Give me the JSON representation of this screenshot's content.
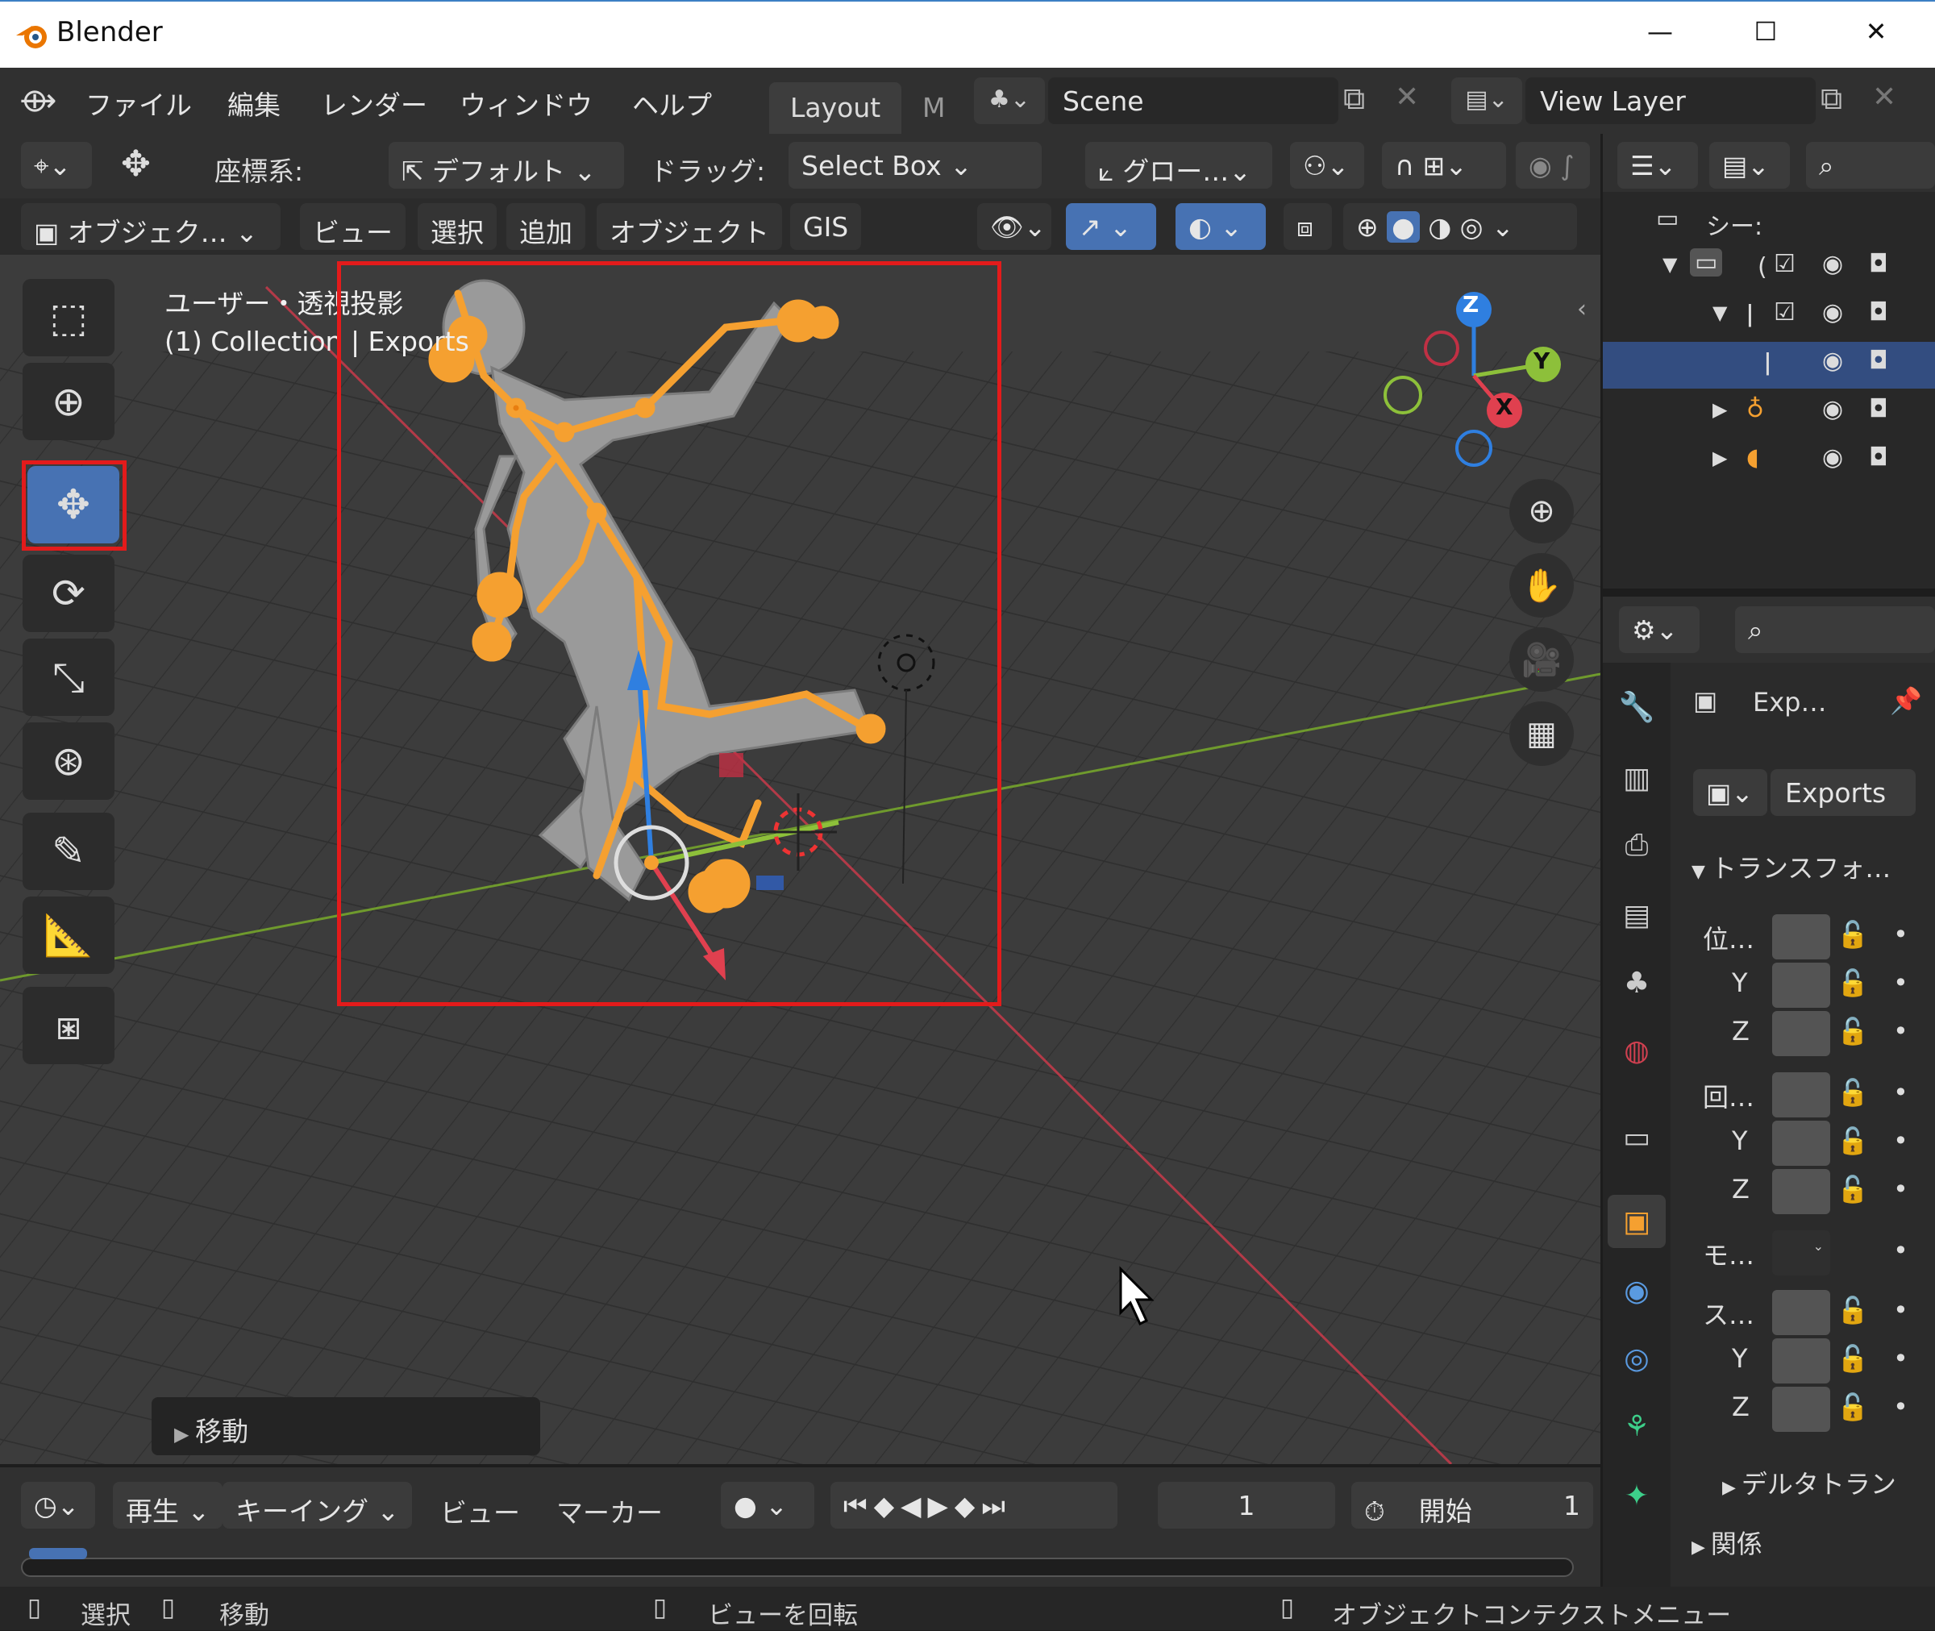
{
  "window": {
    "app_title": "Blender",
    "minimize": "—",
    "maximize": "☐",
    "close": "✕"
  },
  "menubar": {
    "items": [
      "ファイル",
      "編集",
      "レンダー",
      "ウィンドウ",
      "ヘルプ"
    ],
    "workspace_tabs": [
      "Layout",
      "M"
    ],
    "scene": "Scene",
    "view_layer": "View Layer"
  },
  "tool_header": {
    "orientation_label": "座標系:",
    "orientation_value": "デフォルト",
    "drag_label": "ドラッグ:",
    "drag_value": "Select Box",
    "pivot": "グロー…"
  },
  "view_header": {
    "mode": "オブジェク…",
    "menus": [
      "ビュー",
      "選択",
      "追加",
      "オブジェクト",
      "GIS"
    ]
  },
  "viewport": {
    "view_name": "ユーザー・透視投影",
    "collection_info": "(1) Collection | Exports",
    "last_operator": "移動",
    "gizmo_axes": {
      "z": "Z",
      "y": "Y",
      "x": "X"
    }
  },
  "timeline": {
    "menus": {
      "playback": "再生",
      "keying": "キーイング",
      "view": "ビュー",
      "marker": "マーカー"
    },
    "current_frame": "1",
    "start_label": "開始",
    "start_value": "1"
  },
  "statusbar": {
    "select": "選択",
    "move": "移動",
    "rotate_view": "ビューを回転",
    "context_menu": "オブジェクトコンテクストメニュー"
  },
  "outliner": {
    "scene_collection": "シー:",
    "collapsed_label": "("
  },
  "properties": {
    "object_name": "Exp…",
    "data_name": "Exports",
    "transform_header": "トランスフォ…",
    "location_label": "位…",
    "rotation_label": "回…",
    "mode_label": "モ…",
    "scale_label": "ス…",
    "axis_y": "Y",
    "axis_z": "Z",
    "delta_header": "デルタトラン",
    "relations_header": "関係"
  },
  "colors": {
    "accent_blue": "#4772b3",
    "selection_orange": "#f5a030",
    "highlight_red": "#e31b1b",
    "x_axis": "#e0404f",
    "y_axis": "#8dc03a",
    "z_axis": "#2f7fe0"
  }
}
